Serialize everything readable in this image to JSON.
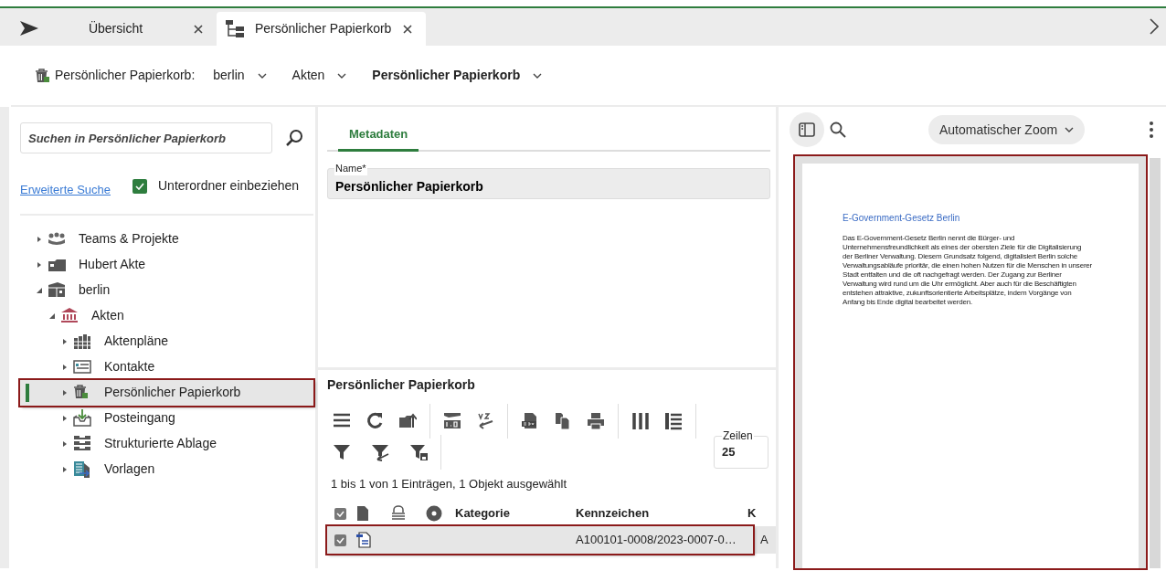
{
  "tabs": [
    {
      "label": "Übersicht",
      "kind": "send",
      "selected": false
    },
    {
      "label": "Persönlicher Papierkorb",
      "kind": "tree",
      "selected": true
    }
  ],
  "breadcrumb": {
    "label": "Persönlicher Papierkorb:",
    "items": [
      {
        "label": "berlin",
        "current": false
      },
      {
        "label": "Akten",
        "current": false
      },
      {
        "label": "Persönlicher Papierkorb",
        "current": true
      }
    ]
  },
  "search": {
    "placeholder": "Suchen in Persönlicher Papierkorb",
    "advanced_link": "Erweiterte Suche",
    "include_subfolders": {
      "label": "Unterordner einbeziehen",
      "checked": true
    }
  },
  "tree": [
    {
      "label": "Teams & Projekte",
      "kind": "team",
      "expanded": false,
      "selected": false
    },
    {
      "label": "Hubert Akte",
      "kind": "cabinet",
      "expanded": false,
      "selected": false
    },
    {
      "label": "berlin",
      "kind": "box",
      "expanded": true,
      "selected": false,
      "children": [
        {
          "label": "Akten",
          "kind": "institution",
          "expanded": true,
          "selected": false,
          "children": [
            {
              "label": "Aktenpläne",
              "kind": "binders",
              "expanded": false,
              "selected": false
            },
            {
              "label": "Kontakte",
              "kind": "card",
              "expanded": false,
              "selected": false
            },
            {
              "label": "Persönlicher Papierkorb",
              "kind": "trash",
              "expanded": false,
              "selected": true
            },
            {
              "label": "Posteingang",
              "kind": "inbox",
              "expanded": false,
              "selected": false
            },
            {
              "label": "Strukturierte Ablage",
              "kind": "trays",
              "expanded": false,
              "selected": false
            },
            {
              "label": "Vorlagen",
              "kind": "template",
              "expanded": false,
              "selected": false
            }
          ]
        }
      ]
    }
  ],
  "metadata": {
    "tabs": [
      {
        "label": "Metadaten",
        "selected": true
      }
    ],
    "field": {
      "label": "Name*",
      "value": "Persönlicher Papierkorb"
    }
  },
  "list": {
    "title": "Persönlicher Papierkorb",
    "rows_field": {
      "label": "Zeilen",
      "value": "25"
    },
    "summary": "1 bis 1 von 1 Einträgen, 1 Objekt ausgewählt",
    "all_checked": true,
    "columns": [
      "Kategorie",
      "Kennzeichen",
      "K"
    ],
    "rows": [
      {
        "selected": true,
        "kategorie": "",
        "kennzeichen": "A100101-0008/2023-0007-0…",
        "column_3": "A"
      }
    ]
  },
  "preview": {
    "zoom": "Automatischer Zoom",
    "doc_title": "E-Government-Gesetz Berlin",
    "doc_lines": [
      "Das E-Government-Gesetz Berlin nennt die Bürger- und",
      "Unternehmensfreundlichkeit als eines der obersten Ziele für die Digitalisierung",
      "der Berliner Verwaltung. Diesem Grundsatz folgend, digitalisiert Berlin solche",
      "Verwaltungsabläufe prioritär, die einen hohen Nutzen für die Menschen in unserer",
      "Stadt entfalten und die oft nachgefragt werden. Der Zugang zur Berliner",
      "Verwaltung wird rund um die Uhr ermöglicht. Aber auch für die Beschäftigten",
      "entstehen attraktive, zukunftsorientierte Arbeitsplätze, indem Vorgänge von",
      "Anfang bis Ende digital bearbeitet werden."
    ]
  }
}
